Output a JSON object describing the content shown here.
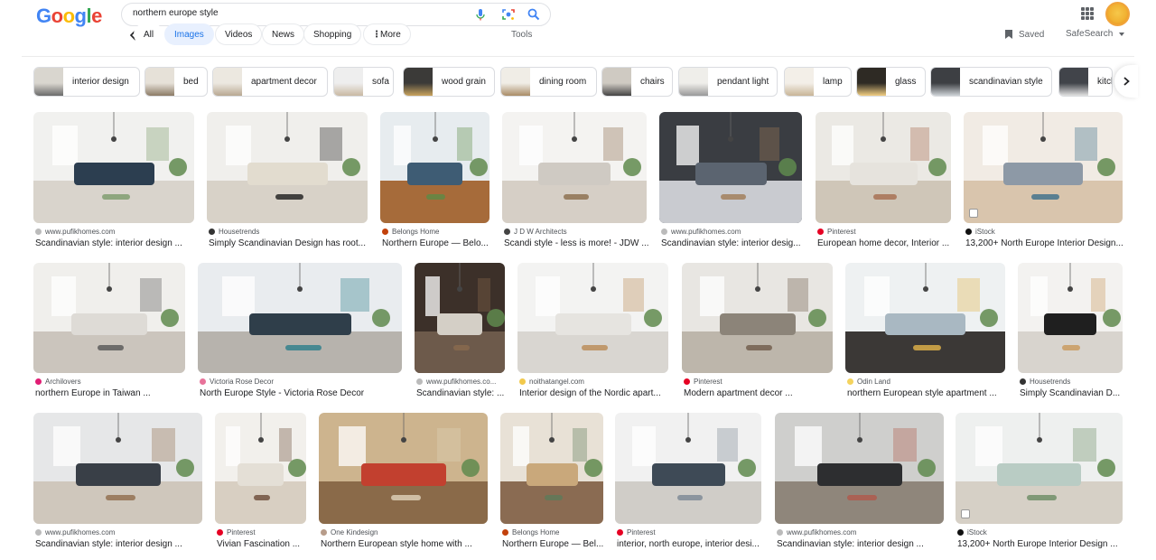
{
  "search": {
    "query": "northern europe style"
  },
  "logo": {
    "text": "Google"
  },
  "nav": {
    "tabs": [
      "All",
      "Images",
      "Videos",
      "News",
      "Shopping",
      "More"
    ],
    "tools": "Tools",
    "saved": "Saved",
    "safesearch": "SafeSearch"
  },
  "chips": [
    "interior design",
    "bed",
    "apartment decor",
    "sofa",
    "wood grain",
    "dining room",
    "chairs",
    "pendant light",
    "lamp",
    "glass",
    "scandinavian style",
    "kitch"
  ],
  "results": [
    {
      "source": "www.pufikhomes.com",
      "title": "Scandinavian style: interior design ..."
    },
    {
      "source": "Housetrends",
      "title": "Simply Scandinavian Design has root..."
    },
    {
      "source": "Belongs Home",
      "title": "Northern Europe — Belo..."
    },
    {
      "source": "J D W Architects",
      "title": "Scandi style - less is more! - JDW ..."
    },
    {
      "source": "www.pufikhomes.com",
      "title": "Scandinavian style: interior desig..."
    },
    {
      "source": "Pinterest",
      "title": "European home decor, Interior ..."
    },
    {
      "source": "iStock",
      "title": "13,200+ North Europe Interior Design..."
    },
    {
      "source": "Archilovers",
      "title": "northern Europe in Taiwan ..."
    },
    {
      "source": "Victoria Rose Decor",
      "title": "North Europe Style - Victoria Rose Decor"
    },
    {
      "source": "www.pufikhomes.co...",
      "title": "Scandinavian style: ..."
    },
    {
      "source": "noithatangel.com",
      "title": "Interior design of the Nordic apart..."
    },
    {
      "source": "Pinterest",
      "title": "Modern apartment decor ..."
    },
    {
      "source": "Odin Land",
      "title": "northern European style apartment ..."
    },
    {
      "source": "Housetrends",
      "title": "Simply Scandinavian D..."
    },
    {
      "source": "www.pufikhomes.com",
      "title": "Scandinavian style: interior design ..."
    },
    {
      "source": "Pinterest",
      "title": "Vivian Fascination ..."
    },
    {
      "source": "One Kindesign",
      "title": "Northern European style home with ..."
    },
    {
      "source": "Belongs Home",
      "title": "Northern Europe — Bel..."
    },
    {
      "source": "Pinterest",
      "title": "interior, north europe, interior desi..."
    },
    {
      "source": "www.pufikhomes.com",
      "title": "Scandinavian style: interior design ..."
    },
    {
      "source": "iStock",
      "title": "13,200+ North Europe Interior Design ..."
    }
  ]
}
